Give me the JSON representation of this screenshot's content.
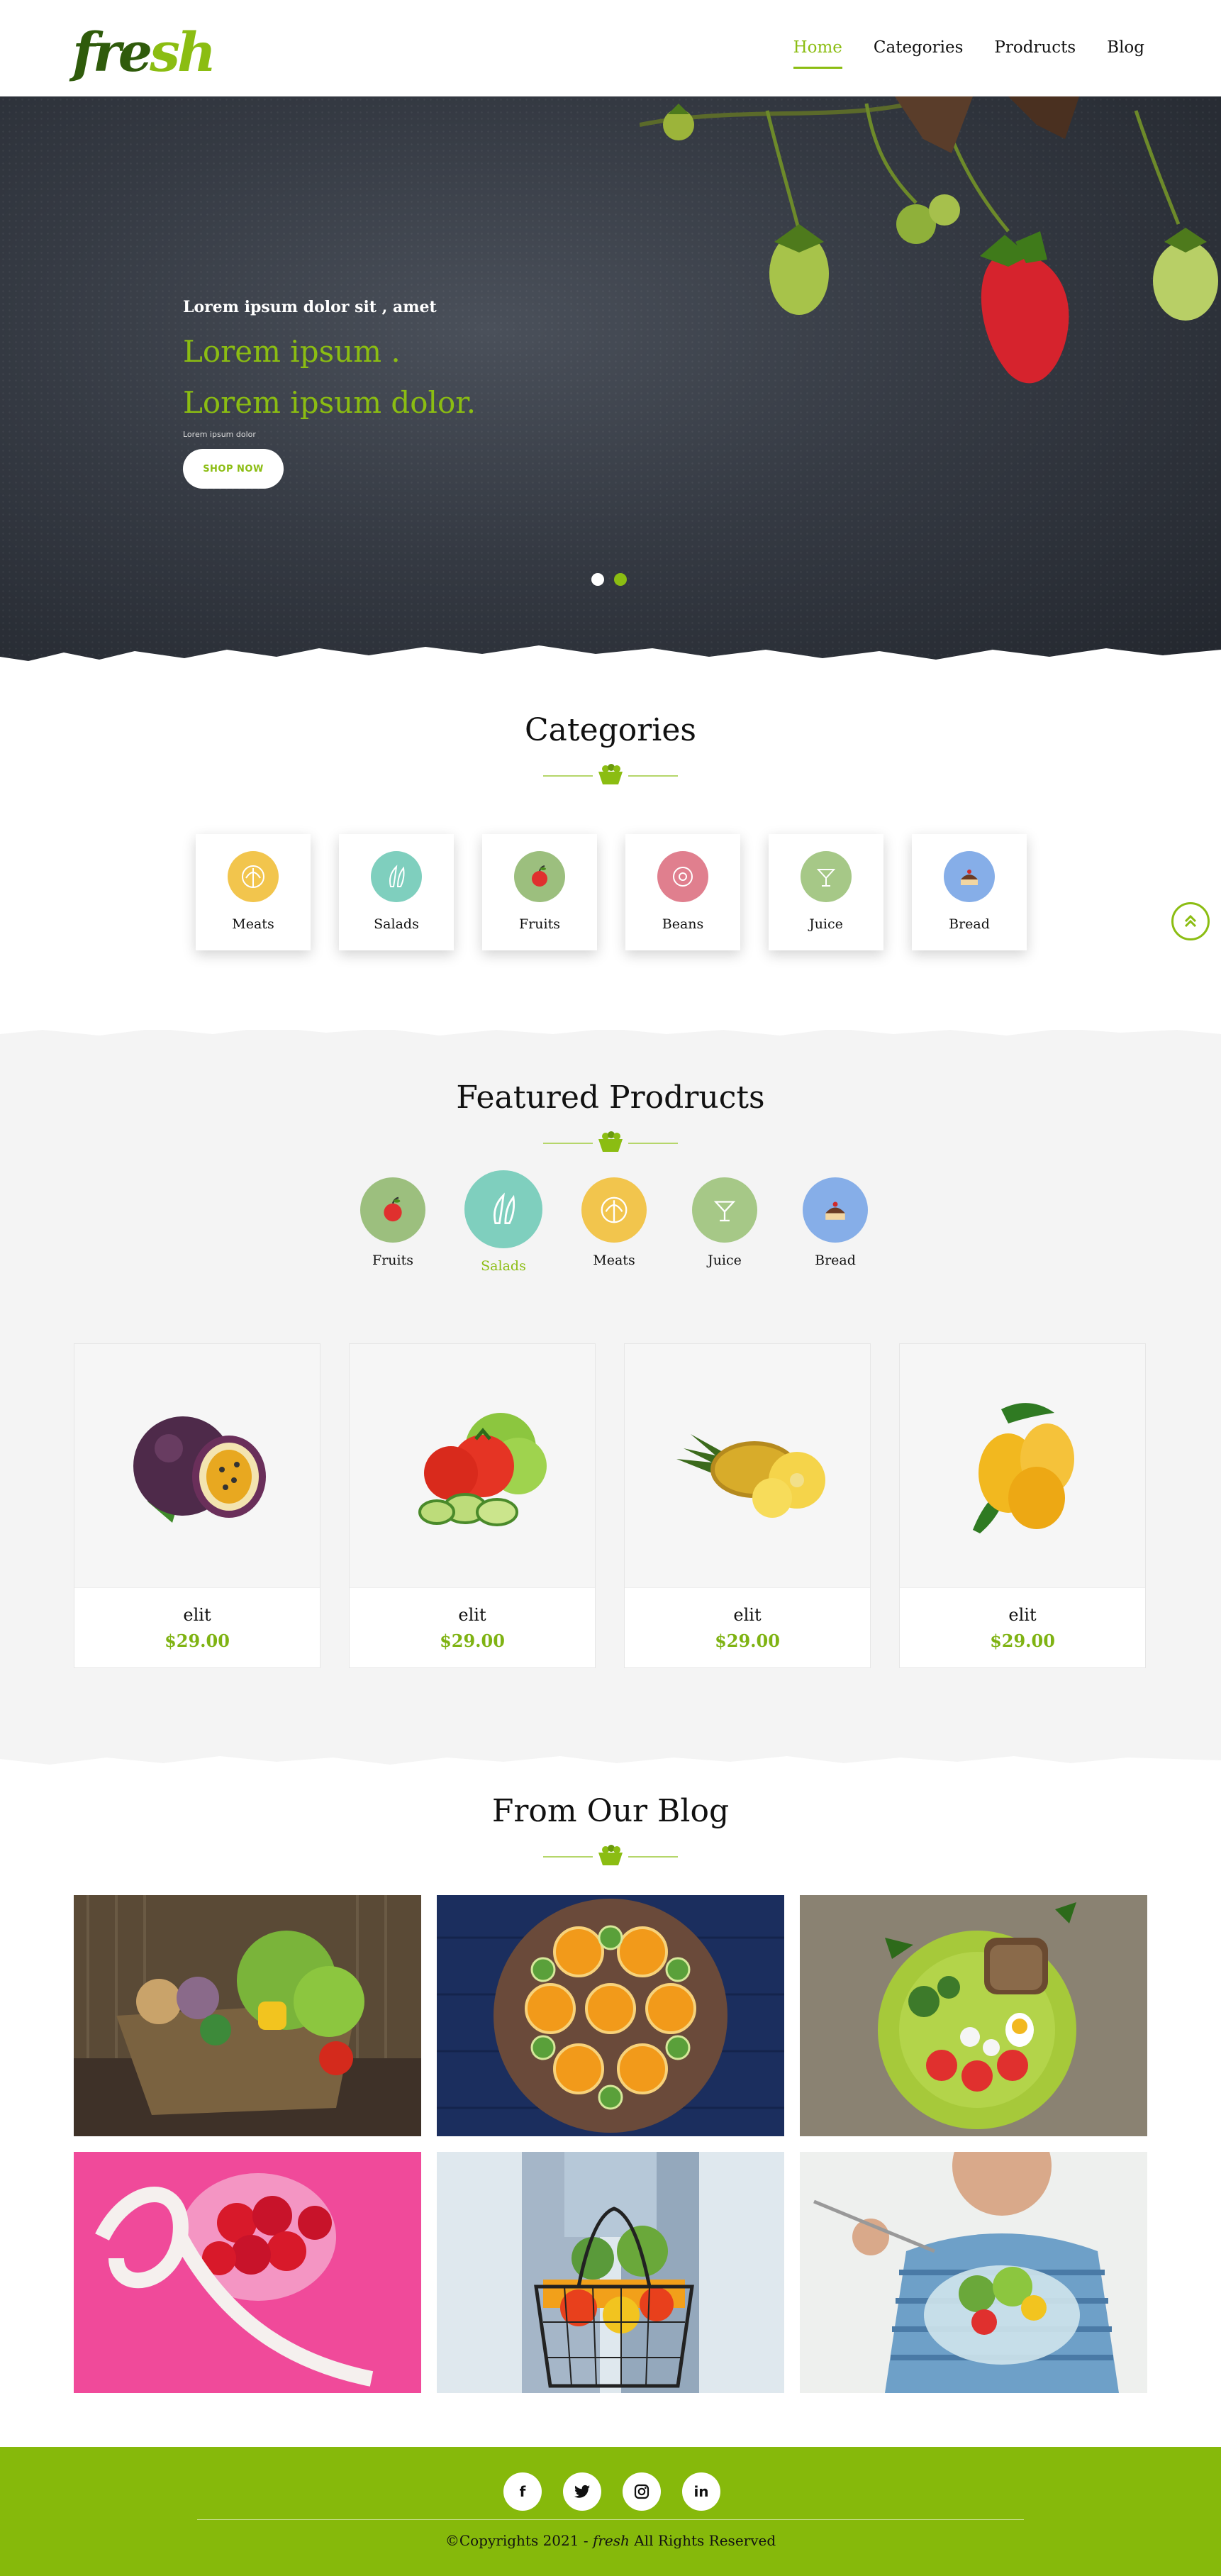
{
  "brand": {
    "logo_text_a": "fre",
    "logo_text_b": "sh",
    "accent": "#8bbd12",
    "dark_green": "#2f5b0b"
  },
  "nav": {
    "items": [
      {
        "label": "Home",
        "active": true
      },
      {
        "label": "Categories"
      },
      {
        "label": "Prodructs"
      },
      {
        "label": "Blog"
      }
    ]
  },
  "hero": {
    "small": "Lorem ipsum dolor sit , amet",
    "big1": "Lorem ipsum .",
    "big2": "Lorem ipsum dolor.",
    "tiny": "Lorem ipsum dolor",
    "button": "SHOP NOW",
    "slides": 2,
    "active_slide": 2
  },
  "categories": {
    "title": "Categories",
    "items": [
      {
        "label": "Meats",
        "color": "#f2c54d",
        "icon": "cabbage-icon"
      },
      {
        "label": "Salads",
        "color": "#7fcfbe",
        "icon": "peapod-icon"
      },
      {
        "label": "Fruits",
        "color": "#9cbf7e",
        "icon": "apple-icon"
      },
      {
        "label": "Beans",
        "color": "#e07f8e",
        "icon": "donut-icon"
      },
      {
        "label": "Juice",
        "color": "#a6c887",
        "icon": "cocktail-icon"
      },
      {
        "label": "Bread",
        "color": "#86aee8",
        "icon": "cake-icon"
      }
    ]
  },
  "featured": {
    "title": "Featured Prodructs",
    "filters": [
      {
        "label": "Fruits",
        "color": "#9cbf7e",
        "icon": "apple-icon"
      },
      {
        "label": "Salads",
        "color": "#7fcfbe",
        "icon": "peapod-icon",
        "active": true
      },
      {
        "label": "Meats",
        "color": "#f2c54d",
        "icon": "cabbage-icon"
      },
      {
        "label": "Juice",
        "color": "#a6c887",
        "icon": "cocktail-icon"
      },
      {
        "label": "Bread",
        "color": "#86aee8",
        "icon": "cake-icon"
      }
    ],
    "products": [
      {
        "name": "elit",
        "price": "$29.00",
        "image": "passion-fruit-image"
      },
      {
        "name": "elit",
        "price": "$29.00",
        "image": "tomato-cucumber-image"
      },
      {
        "name": "elit",
        "price": "$29.00",
        "image": "pineapple-image"
      },
      {
        "name": "elit",
        "price": "$29.00",
        "image": "mango-image"
      }
    ]
  },
  "blog": {
    "title": "From Our Blog",
    "images": [
      "vegetable-basket-image",
      "orange-kiwi-board-image",
      "salad-plate-image",
      "strawberries-tape-image",
      "shopping-basket-image",
      "man-eating-salad-image"
    ]
  },
  "footer": {
    "socials": [
      "f",
      "twitter",
      "instagram",
      "in"
    ],
    "copy_prefix": "©Copyrights 2021 - ",
    "copy_brand": "fresh",
    "copy_suffix": " All Rights Reserved"
  }
}
